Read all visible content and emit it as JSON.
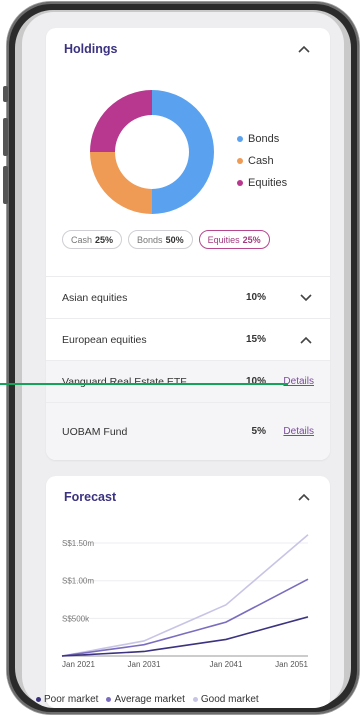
{
  "holdings": {
    "title": "Holdings",
    "chart_data": {
      "type": "pie",
      "categories": [
        "Bonds",
        "Cash",
        "Equities"
      ],
      "values": [
        50,
        25,
        25
      ]
    },
    "legend": [
      {
        "label": "Bonds",
        "color": "#5aa2ef"
      },
      {
        "label": "Cash",
        "color": "#ef9a55"
      },
      {
        "label": "Equities",
        "color": "#b8378f"
      }
    ],
    "pills": [
      {
        "label": "Cash",
        "value": "25%",
        "active": false
      },
      {
        "label": "Bonds",
        "value": "50%",
        "active": false
      },
      {
        "label": "Equities",
        "value": "25%",
        "active": true
      }
    ],
    "rows": [
      {
        "name": "Asian equities",
        "pct": "10%",
        "action": "chevron-down"
      },
      {
        "name": "European equities",
        "pct": "15%",
        "action": "chevron-up"
      },
      {
        "name": "Vanguard Real Estate ETF",
        "pct": "10%",
        "action": "Details"
      },
      {
        "name": "UOBAM Fund",
        "pct": "5%",
        "action": "Details"
      }
    ]
  },
  "forecast": {
    "title": "Forecast",
    "chart_data": {
      "type": "line",
      "x": [
        "Jan 2021",
        "Jan 2031",
        "Jan 2041",
        "Jan 2051"
      ],
      "yticks": [
        "S$500k",
        "S$1.00m",
        "S$1.50m"
      ],
      "series": [
        {
          "name": "Poor market",
          "color": "#3b3380",
          "values": [
            0,
            60000,
            220000,
            520000
          ]
        },
        {
          "name": "Average market",
          "color": "#7a6dc0",
          "values": [
            0,
            150000,
            450000,
            1020000
          ]
        },
        {
          "name": "Good market",
          "color": "#c8c4e6",
          "values": [
            0,
            200000,
            680000,
            1610000
          ]
        }
      ]
    }
  }
}
